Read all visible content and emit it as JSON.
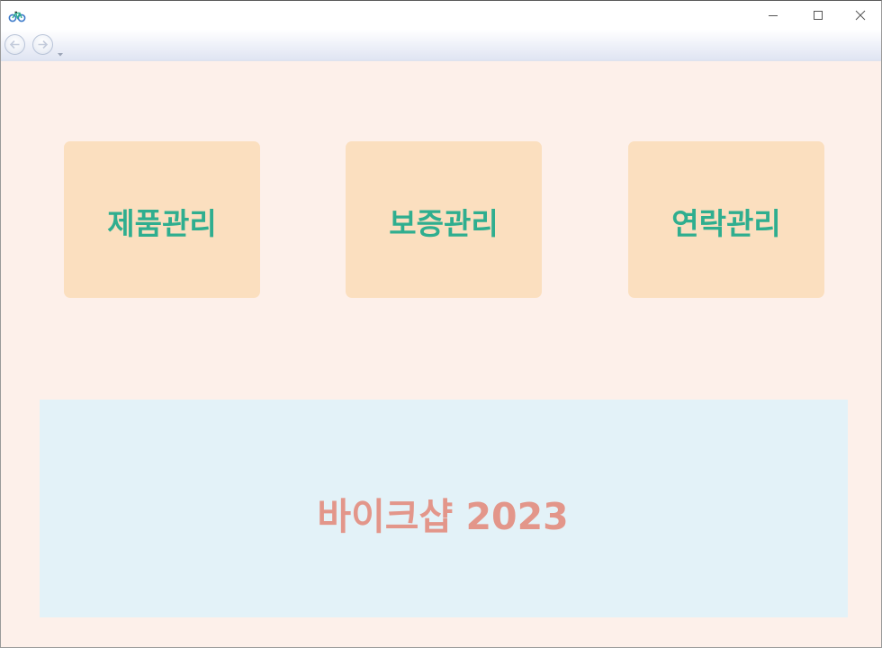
{
  "window": {
    "app_icon": "bicycle-icon",
    "controls": [
      "minimize-icon",
      "maximize-icon",
      "close-icon"
    ]
  },
  "navbar": {
    "back_icon": "arrow-left-icon",
    "forward_icon": "arrow-right-icon",
    "dropdown_icon": "chevron-down-icon"
  },
  "menu": {
    "tiles": [
      {
        "label": "제품관리"
      },
      {
        "label": "보증관리"
      },
      {
        "label": "연락관리"
      }
    ]
  },
  "banner": {
    "label": "바이크샵 2023"
  },
  "colors": {
    "page_background": "#fdf0ea",
    "tile_background": "#fbdfbf",
    "tile_text": "#2fae8f",
    "banner_background": "#e3f2f8",
    "banner_text": "#e3968a"
  }
}
